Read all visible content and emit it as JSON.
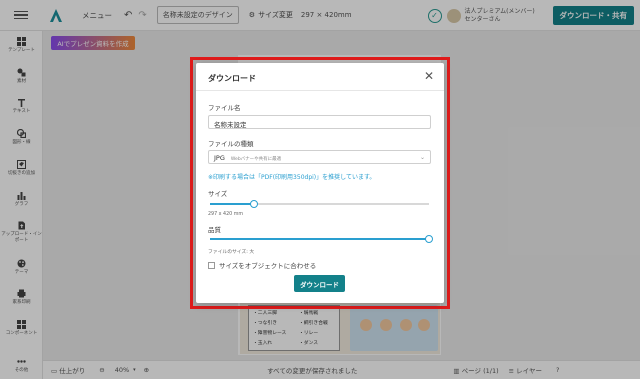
{
  "header": {
    "menu_label": "メニュー",
    "doc_name": "名称未設定のデザイン",
    "size_change_label": "サイズ変更",
    "size_dims": "297 × 420mm",
    "user_line1": "法人プレミアム(メンバー)",
    "user_line2": "センターさん",
    "download_share_label": "ダウンロード・共有"
  },
  "sidebar": {
    "items": [
      {
        "label": "テンプレート",
        "icon": "template-icon"
      },
      {
        "label": "素材",
        "icon": "material-icon"
      },
      {
        "label": "テキスト",
        "icon": "text-icon"
      },
      {
        "label": "図形・線",
        "icon": "shape-icon"
      },
      {
        "label": "切抜きの追加",
        "icon": "cutout-icon"
      },
      {
        "label": "グラフ",
        "icon": "chart-icon"
      },
      {
        "label": "アップロード・インポート",
        "icon": "upload-icon"
      },
      {
        "label": "テーマ",
        "icon": "theme-icon"
      },
      {
        "label": "家系印刷",
        "icon": "print-icon"
      },
      {
        "label": "コンポーネント",
        "icon": "component-icon"
      },
      {
        "label": "その他",
        "icon": "more-icon"
      }
    ]
  },
  "canvas": {
    "ai_button_label": "AIでプレゼン資料を作成",
    "doc_list": [
      "・二人三脚",
      "・つな引き",
      "・障害物レース",
      "・玉入れ",
      "・騎馬戦",
      "・綱引き合戦",
      "・リレー",
      "・ダンス"
    ]
  },
  "modal": {
    "title": "ダウンロード",
    "filename_label": "ファイル名",
    "filename_value": "名称未設定",
    "filetype_label": "ファイルの種類",
    "filetype_value": "JPG",
    "filetype_hint": "Webバナーや共有に最適",
    "print_note": "※印刷する場合は「PDF(印刷用350dpi)」を推奨しています。",
    "size_label": "サイズ",
    "size_value_text": "297 x 420 mm",
    "size_level": 0.2,
    "quality_label": "品質",
    "quality_level": 1.0,
    "filesize_text": "ファイルのサイズ: 大",
    "fit_object_label": "サイズをオブジェクトに合わせる",
    "download_button": "ダウンロード"
  },
  "bottombar": {
    "finish_label": "仕上がり",
    "zoom": "40%",
    "saved_status": "すべての変更が保存されました",
    "page_label": "ページ",
    "page_count": "(1/1)",
    "layer_label": "レイヤー"
  },
  "colors": {
    "accent": "#13818a",
    "slider": "#2a9fd0",
    "highlight": "#e01b1b"
  }
}
